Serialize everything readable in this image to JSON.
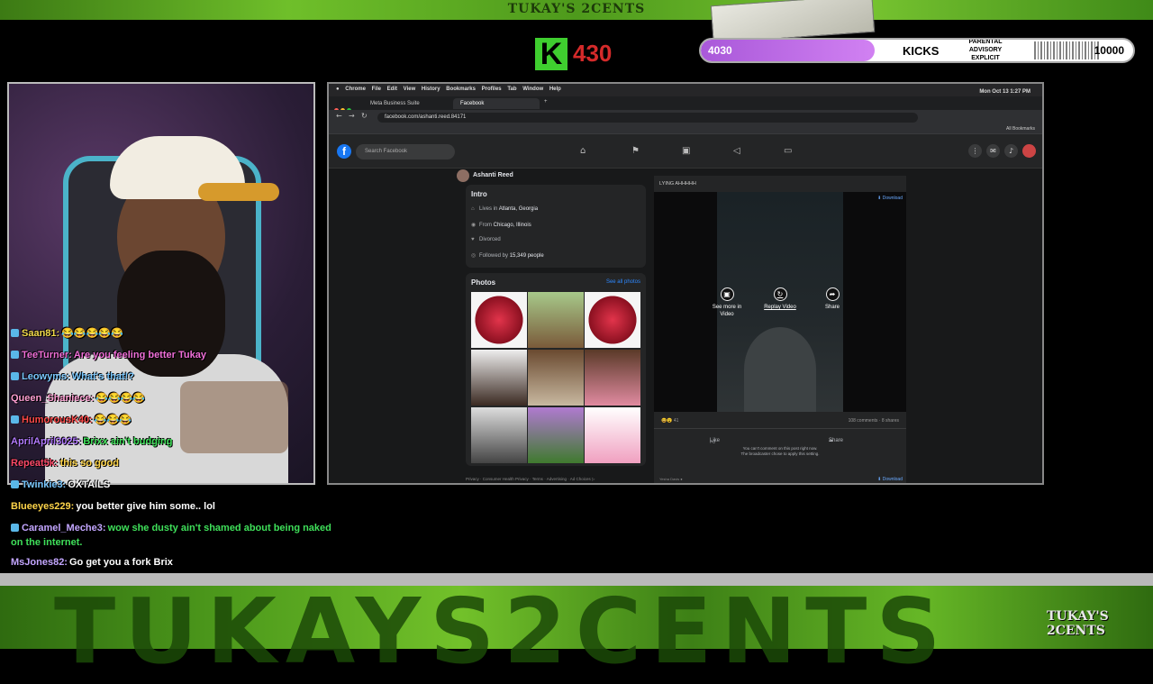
{
  "overlay": {
    "top_title": "TUKAY'S 2CENTS",
    "k_letter": "K",
    "k_count": "430",
    "goal_current": "4030",
    "goal_label": "KICKS",
    "goal_target": "10000",
    "goal_progress": 0.403,
    "parental": "PARENTAL ADVISORY EXPLICIT CONTENT",
    "bottom_banner": "TUKAYS2CENTS",
    "brand_logo": "TUKAY'S 2CENTS"
  },
  "chat": [
    {
      "user": "Saan81:",
      "text": "😂😂😂😂😂"
    },
    {
      "user": "TeeTurner:",
      "text": "Are you feeling better Tukay"
    },
    {
      "user": "Leowyms:",
      "text": "What's that!?"
    },
    {
      "user": "Queen_Shaniece:",
      "text": "😂😂😂😂"
    },
    {
      "user": "HumorousK40:",
      "text": "😂😂😂"
    },
    {
      "user": "AprilApril3025:",
      "text": "Brixx ain't budging"
    },
    {
      "user": "Repeat5k:",
      "text": "this so good"
    },
    {
      "user": "Twinkie3:",
      "text": "OXTAILS"
    },
    {
      "user": "Blueeyes229:",
      "text": "you better give him some.. lol"
    },
    {
      "user": "Caramel_Meche3:",
      "text": "wow she dusty ain't shamed about being naked on the internet."
    },
    {
      "user": "MsJones82:",
      "text": "Go get you a fork Brix"
    }
  ],
  "browser": {
    "mac_menu": [
      "Chrome",
      "File",
      "Edit",
      "View",
      "History",
      "Bookmarks",
      "Profiles",
      "Tab",
      "Window",
      "Help"
    ],
    "clock": "Mon Oct 13  1:27 PM",
    "tabs": [
      "Meta Business Suite",
      "Facebook"
    ],
    "url": "facebook.com/ashanti.reed.84171",
    "all_bookmarks": "All Bookmarks"
  },
  "facebook": {
    "search_placeholder": "Search Facebook",
    "profile_name": "Ashanti Reed",
    "intro_title": "Intro",
    "intro": {
      "lives_prefix": "Lives in ",
      "lives": "Atlanta, Georgia",
      "from_prefix": "From ",
      "from": "Chicago, Illinois",
      "status": "Divorced",
      "followed_prefix": "Followed by ",
      "followed": "15,349 people"
    },
    "photos_title": "Photos",
    "see_all": "See all photos",
    "footer": "Privacy · Consumer Health Privacy · Terms · Advertising · Ad Choices ▷",
    "post": {
      "title": "LYING AHHHHH",
      "download": "⬇ Download",
      "btn_more": "See more in Video",
      "btn_replay": "Replay Video",
      "btn_share": "Share",
      "reactions": "😆😮 41",
      "counts": "108 comments · 8 shares",
      "like": "Like",
      "share": "Share",
      "no_comment_1": "You can't comment on this post right now.",
      "no_comment_2": "The broadcaster chose to apply this setting.",
      "next_author": "Yesha Davis ●"
    }
  },
  "colors": {
    "accent_green": "#3fce2f",
    "count_red": "#d42a2a",
    "goal_purple": "#c074e8",
    "fb_blue": "#1877f2"
  }
}
